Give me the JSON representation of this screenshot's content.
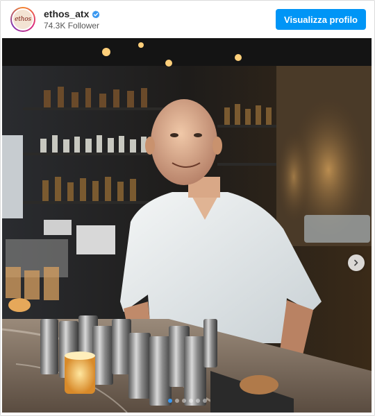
{
  "post": {
    "username": "ethos_atx",
    "avatar_text": "ethos",
    "followers": "74.3K Follower",
    "profile_button": "Visualizza profilo",
    "verified": true
  },
  "carousel": {
    "slide_count": 6,
    "active_index": 0
  },
  "colors": {
    "accent": "#0095f6",
    "dot_active": "#3897f0"
  },
  "icons": {
    "verified": "verified-badge-icon",
    "next": "chevron-right-icon"
  }
}
